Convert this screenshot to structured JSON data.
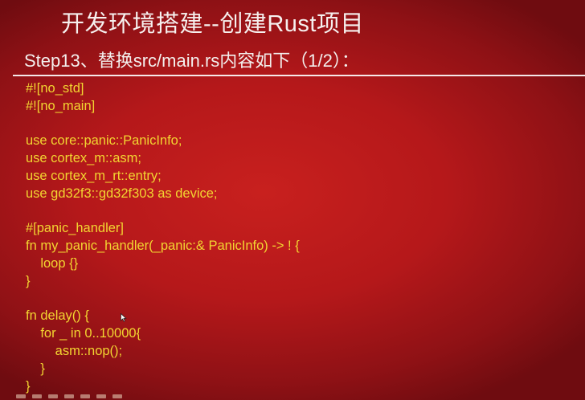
{
  "slide": {
    "title": "开发环境搭建--创建Rust项目",
    "subtitle": "Step13、替换src/main.rs内容如下（1/2）：",
    "code_lines": [
      "#![no_std]",
      "#![no_main]",
      "",
      "use core::panic::PanicInfo;",
      "use cortex_m::asm;",
      "use cortex_m_rt::entry;",
      "use gd32f3::gd32f303 as device;",
      "",
      "#[panic_handler]",
      "fn my_panic_handler(_panic:& PanicInfo) -> ! {",
      "    loop {}",
      "}",
      "",
      "fn delay() {",
      "    for _ in 0..10000{",
      "        asm::nop();",
      "    }",
      "}"
    ]
  },
  "colors": {
    "background": "#b5181a",
    "title_text": "#f6f0ee",
    "code_text": "#f2d531"
  },
  "icons": {
    "cursor": "mouse-pointer-icon"
  }
}
